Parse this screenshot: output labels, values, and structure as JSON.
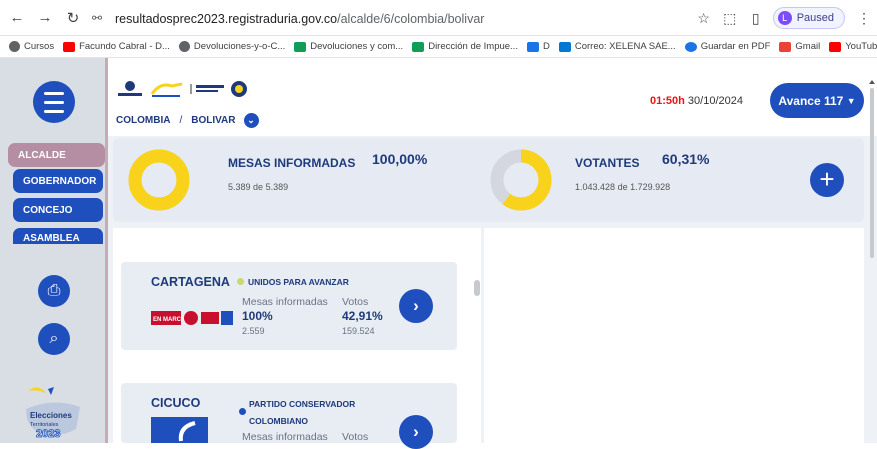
{
  "browser": {
    "url_host": "resultadosprec2023.registraduria.gov.co",
    "url_path": "/alcalde/6/colombia/bolivar",
    "profile_initial": "L",
    "profile_status": "Paused",
    "bookmarks": [
      {
        "label": "Cursos",
        "color": "#5f6368"
      },
      {
        "label": "Facundo Cabral - D...",
        "color": "#ff0000"
      },
      {
        "label": "Devoluciones-y-o-C...",
        "color": "#5f6368"
      },
      {
        "label": "Devoluciones y com...",
        "color": "#0f9d58"
      },
      {
        "label": "Dirección de Impue...",
        "color": "#0f9d58"
      },
      {
        "label": "D",
        "color": "#1a73e8"
      },
      {
        "label": "Correo: XELENA SAE...",
        "color": "#0078d4"
      },
      {
        "label": "Guardar en PDF",
        "color": "#1a73e8"
      },
      {
        "label": "Gmail",
        "color": "#ea4335"
      },
      {
        "label": "YouTube",
        "color": "#ff0000"
      }
    ]
  },
  "sidebar": {
    "items": [
      {
        "label": "ALCALDE",
        "active": true
      },
      {
        "label": "GOBERNADOR",
        "active": false
      },
      {
        "label": "CONCEJO",
        "active": false
      },
      {
        "label": "ASAMBLEA",
        "active": false
      }
    ],
    "logo_text": "Elecciones Territoriales 2023"
  },
  "header": {
    "breadcrumb": [
      "COLOMBIA",
      "BOLIVAR"
    ],
    "separator": "/",
    "time": "01:50h",
    "date": "30/10/2024",
    "avance_label": "Avance 117"
  },
  "stats": {
    "mesas": {
      "title": "MESAS INFORMADAS",
      "percent": "100,00%",
      "count": "5.389",
      "of": "de",
      "total": "5.389",
      "fraction": 1.0
    },
    "votantes": {
      "title": "VOTANTES",
      "percent": "60,31%",
      "count": "1.043.428",
      "of": "de",
      "total": "1.729.928",
      "fraction": 0.6031
    }
  },
  "cards": [
    {
      "name": "CARTAGENA",
      "party": "UNIDOS PARA AVANZAR",
      "party_dot": "#c9d96a",
      "mesas_label": "Mesas informadas",
      "mesas_pct": "100%",
      "mesas_count": "2.559",
      "votos_label": "Votos",
      "votos_pct": "42,91%",
      "votos_count": "159.524"
    },
    {
      "name": "CICUCO",
      "party_line1": "PARTIDO CONSERVADOR",
      "party_line2": "COLOMBIANO",
      "party_dot": "#1e4fbd",
      "mesas_label": "Mesas informadas",
      "votos_label": "Votos"
    }
  ],
  "colors": {
    "brand_blue": "#1e4fbd",
    "ring_yellow": "#f9d21b",
    "ring_gray": "#d4d8de",
    "active_pink": "#b68ea3"
  }
}
